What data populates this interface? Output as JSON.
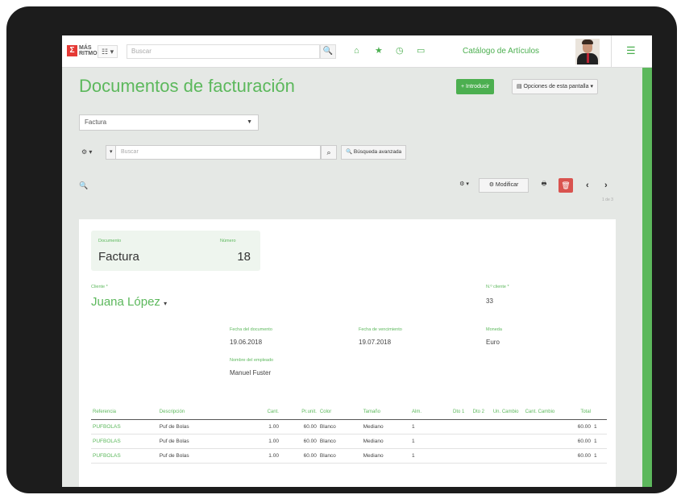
{
  "header": {
    "logo_mark": "Σ",
    "logo_text": "MÁS RITMO",
    "apps_label": "☷ ▾",
    "search_placeholder": "Buscar",
    "search_icon": "🔍",
    "catalog_link": "Catálogo de Artículos",
    "menu_icon": "☰"
  },
  "page": {
    "title": "Documentos de facturación",
    "new_button": "+ Introducir",
    "options_button": "▤ Opciones de esta pantalla ▾"
  },
  "filters": {
    "doc_type_select": "Factura",
    "gear_label": "⚙ ▾",
    "dropdown_label": "▾",
    "search_placeholder": "Buscar",
    "advanced_search": "🔍 Búsqueda avanzada"
  },
  "toolbar": {
    "zoom_label": "🔍",
    "gear_label": "⚙ ▾",
    "modify_label": "⚙ Modificar",
    "print_label": "🖶",
    "delete_label": "🗑",
    "prev_label": "‹",
    "next_label": "›",
    "record_count": "1 de 3"
  },
  "form": {
    "document_label": "Documento",
    "number_label": "Número",
    "document_type": "Factura",
    "document_number": "18",
    "client_label": "Cliente *",
    "client_name": "Juana López",
    "client_code_label": "N.º cliente *",
    "client_code": "33",
    "issue_date_label": "Fecha del documento",
    "issue_date": "19.06.2018",
    "due_date_label": "Fecha de vencimiento",
    "due_date": "19.07.2018",
    "currency_label": "Moneda",
    "currency": "Euro",
    "employee_label": "Nombre del empleado",
    "employee": "Manuel Fuster"
  },
  "lines": {
    "headers": [
      "Referencia",
      "Descripción",
      "Cant.",
      "Pr.unit.",
      "Color",
      "Tamaño",
      "Alm.",
      "Dto 1",
      "Dto 2",
      "Un. Cambio",
      "Cant. Cambio",
      "Total",
      ""
    ],
    "rows": [
      [
        "PUFBOLAS",
        "Puf de Bolas",
        "1.00",
        "60.00",
        "Blanco",
        "Mediano",
        "1",
        "",
        "",
        "",
        "",
        "60.00",
        "1"
      ],
      [
        "PUFBOLAS",
        "Puf de Bolas",
        "1.00",
        "60.00",
        "Blanco",
        "Mediano",
        "1",
        "",
        "",
        "",
        "",
        "60.00",
        "1"
      ],
      [
        "PUFBOLAS",
        "Puf de Bolas",
        "1.00",
        "60.00",
        "Blanco",
        "Mediano",
        "1",
        "",
        "",
        "",
        "",
        "60.00",
        "1"
      ]
    ]
  },
  "colors": {
    "accent_green": "#5cb85c",
    "delete_red": "#d9534f",
    "background": "#e5e8e5"
  }
}
